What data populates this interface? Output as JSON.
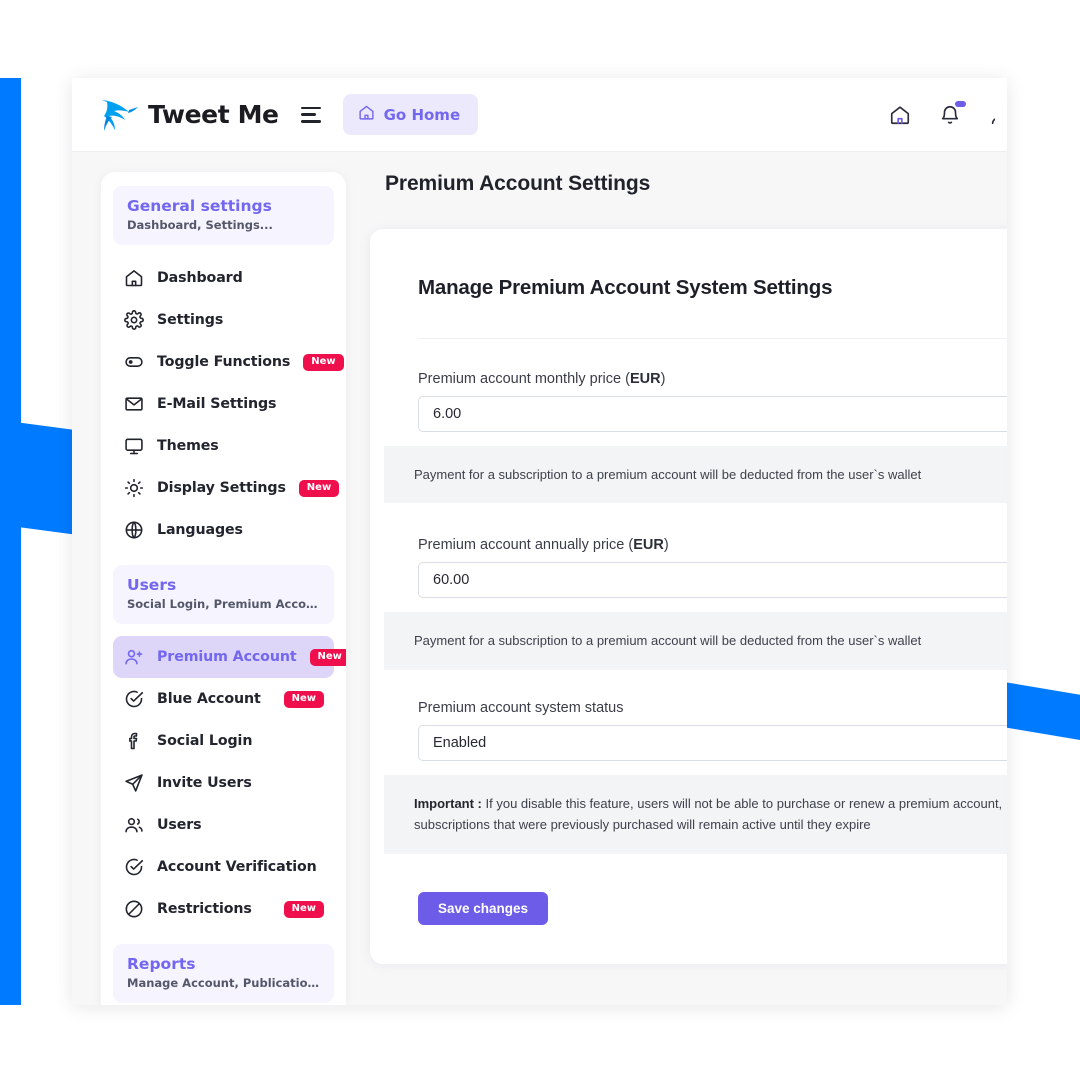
{
  "theme": {
    "accent_blue": "#007bff",
    "accent_purple": "#6c5ce7",
    "badge_red": "#ef0f4c"
  },
  "header": {
    "brand_name": "Tweet Me",
    "logo_icon": "hummingbird-logo",
    "menu_icon": "hamburger-icon",
    "go_home_label": "Go Home",
    "go_home_icon": "home-icon",
    "right_icons": [
      {
        "name": "home-icon",
        "badge": false
      },
      {
        "name": "bell-icon",
        "badge": true
      },
      {
        "name": "user-icon",
        "badge": false
      }
    ]
  },
  "sidebar": {
    "groups": [
      {
        "title": "General settings",
        "subtitle": "Dashboard, Settings...",
        "items": [
          {
            "label": "Dashboard",
            "icon": "home-icon",
            "badge": null,
            "active": false
          },
          {
            "label": "Settings",
            "icon": "gear-icon",
            "badge": null,
            "active": false
          },
          {
            "label": "Toggle Functions",
            "icon": "toggle-icon",
            "badge": "New",
            "active": false
          },
          {
            "label": "E-Mail Settings",
            "icon": "mail-icon",
            "badge": null,
            "active": false
          },
          {
            "label": "Themes",
            "icon": "monitor-icon",
            "badge": null,
            "active": false
          },
          {
            "label": "Display Settings",
            "icon": "sun-icon",
            "badge": "New",
            "active": false
          },
          {
            "label": "Languages",
            "icon": "globe-icon",
            "badge": null,
            "active": false
          }
        ]
      },
      {
        "title": "Users",
        "subtitle": "Social Login, Premium Account, Us…",
        "items": [
          {
            "label": "Premium Account",
            "icon": "user-plus-icon",
            "badge": "New",
            "active": true
          },
          {
            "label": "Blue Account",
            "icon": "check-circle-icon",
            "badge": "New",
            "active": false
          },
          {
            "label": "Social Login",
            "icon": "facebook-icon",
            "badge": null,
            "active": false
          },
          {
            "label": "Invite Users",
            "icon": "send-icon",
            "badge": null,
            "active": false
          },
          {
            "label": "Users",
            "icon": "users-icon",
            "badge": null,
            "active": false
          },
          {
            "label": "Account Verification",
            "icon": "check-circle-icon",
            "badge": null,
            "active": false
          },
          {
            "label": "Restrictions",
            "icon": "ban-icon",
            "badge": "New",
            "active": false
          }
        ]
      },
      {
        "title": "Reports",
        "subtitle": "Manage Account, Publication Repor…",
        "items": []
      }
    ]
  },
  "main": {
    "page_title": "Premium Account Settings",
    "card_title": "Manage Premium Account System Settings",
    "fields": [
      {
        "label_text": "Premium account monthly price (",
        "label_bold": "EUR",
        "label_tail": ")",
        "value": "6.00",
        "help_prefix": "",
        "help_text": "Payment for a subscription to a premium account will be deducted from the user`s wallet"
      },
      {
        "label_text": "Premium account annually price (",
        "label_bold": "EUR",
        "label_tail": ")",
        "value": "60.00",
        "help_prefix": "",
        "help_text": "Payment for a subscription to a premium account will be deducted from the user`s wallet"
      },
      {
        "label_text": "Premium account system status",
        "label_bold": "",
        "label_tail": "",
        "value": "Enabled",
        "help_prefix": "Important :",
        "help_text": " If you disable this feature, users will not be able to purchase or renew a premium account, subscriptions that were previously purchased will remain active until they expire"
      }
    ],
    "save_label": "Save changes"
  }
}
